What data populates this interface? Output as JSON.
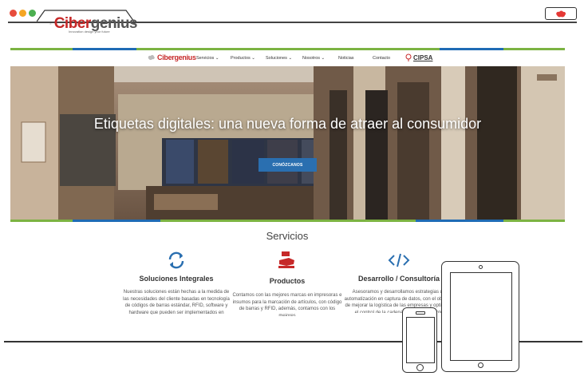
{
  "window": {
    "brand": "Cibergenius",
    "brand_tagline": "Innovation design your future",
    "traffic_colors": [
      "#e74c3c",
      "#f5a623",
      "#4caf50"
    ]
  },
  "site": {
    "nav": {
      "logo_text": "Cibergenius",
      "items": [
        "Servicios",
        "Productos",
        "Soluciones",
        "Nosotros",
        "Noticias",
        "Contacto"
      ],
      "dropdown_items": [
        true,
        true,
        true,
        true,
        false,
        false
      ],
      "partner": "CIPSA"
    },
    "hero": {
      "title": "Etiquetas digitales: una nueva forma de atraer al consumidor",
      "button": "CONÓZCANOS"
    },
    "services": {
      "title": "Servicios",
      "items": [
        {
          "name": "Soluciones Integrales",
          "icon": "refresh-icon",
          "description": "Nuestras soluciones están hechas a la medida de las necesidades del cliente basadas en tecnología de códigos de barras estándar, RFID, software y hardware que pueden ser implementados en"
        },
        {
          "name": "Productos",
          "icon": "hand-icon",
          "description": "Contamos con las mejores marcas en impresoras e insumos para la marcación de artículos, con código de barras y RFID, además, contamos con los mejores"
        },
        {
          "name": "Desarrollo / Consultoría",
          "icon": "code-icon",
          "description": "Asesoramos y desarrollamos estrategias de automatización en captura de datos, con el objetivo de mejorar la logística de las empresas y optimizar el control de la cadena de abastecimiento"
        }
      ]
    },
    "colors": {
      "accent_blue": "#2a6fb0",
      "brand_red": "#c62828",
      "stripe_green": "#7cb342",
      "stripe_blue": "#1f6bb5"
    }
  }
}
